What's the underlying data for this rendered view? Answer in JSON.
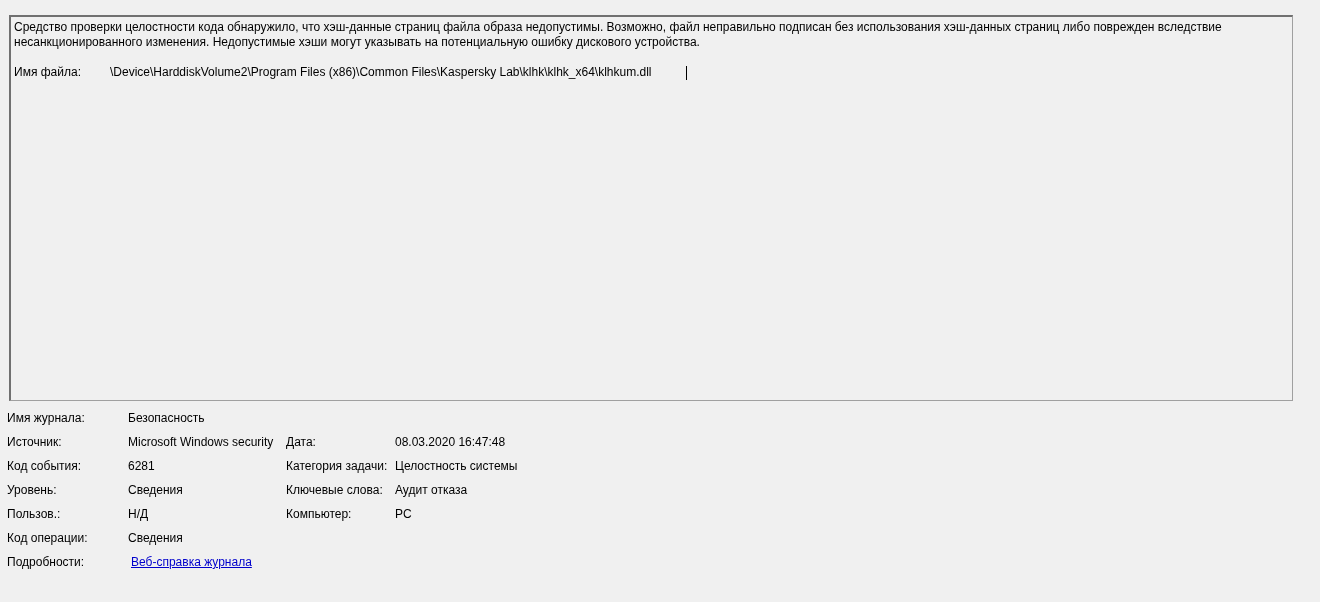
{
  "description": {
    "message": "Средство проверки целостности кода обнаружило, что хэш-данные страниц файла образа недопустимы. Возможно, файл неправильно подписан без использования хэш-данных страниц либо поврежден вследствие несанкционированного изменения. Недопустимые хэши могут указывать на потенциальную ошибку дискового устройства.",
    "file_label": "Имя файла:",
    "file_path": "\\Device\\HarddiskVolume2\\Program Files (x86)\\Common Files\\Kaspersky Lab\\klhk\\klhk_x64\\klhkum.dll"
  },
  "properties": [
    {
      "label": "Имя журнала:",
      "value": "Безопасность"
    },
    {
      "label": "Источник:",
      "value": "Microsoft Windows security",
      "label2": "Дата:",
      "value2": "08.03.2020 16:47:48"
    },
    {
      "label": "Код события:",
      "value": "6281",
      "label2": "Категория задачи:",
      "value2": "Целостность системы"
    },
    {
      "label": "Уровень:",
      "value": "Сведения",
      "label2": "Ключевые слова:",
      "value2": "Аудит отказа"
    },
    {
      "label": "Пользов.:",
      "value": "Н/Д",
      "label2": "Компьютер:",
      "value2": "PC"
    },
    {
      "label": "Код операции:",
      "value": "Сведения"
    },
    {
      "label": "Подробности:",
      "link": "Веб-справка журнала"
    }
  ]
}
